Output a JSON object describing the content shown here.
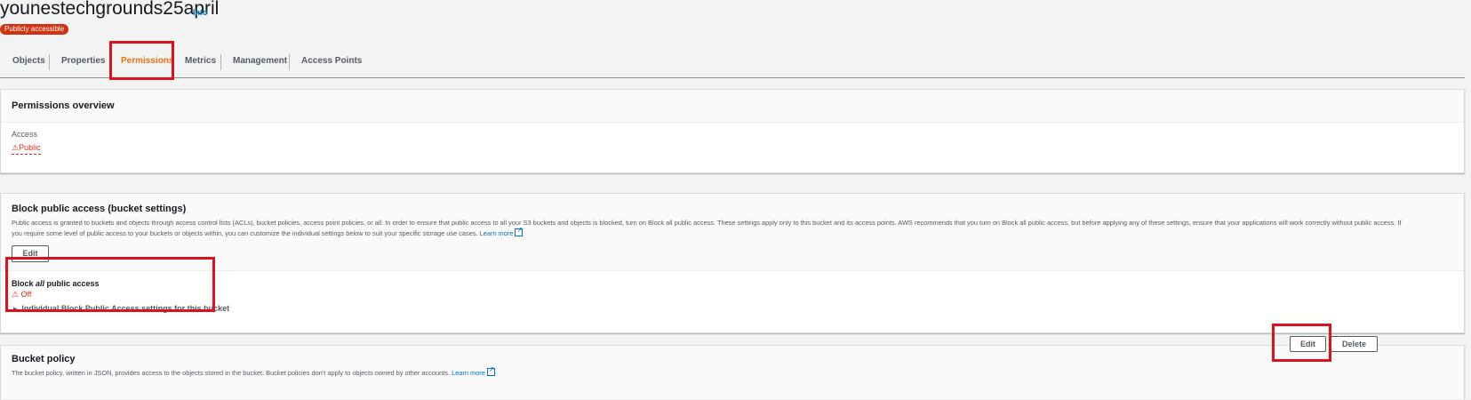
{
  "bucket": {
    "name": "younestechgrounds25april",
    "info_label": "Info",
    "badge": "Publicly accessible"
  },
  "tabs": [
    {
      "label": "Objects"
    },
    {
      "label": "Properties"
    },
    {
      "label": "Permissions"
    },
    {
      "label": "Metrics"
    },
    {
      "label": "Management"
    },
    {
      "label": "Access Points"
    }
  ],
  "active_tab": "Permissions",
  "permissions_overview": {
    "title": "Permissions overview",
    "access_label": "Access",
    "access_value": "Public"
  },
  "block_public_access": {
    "title": "Block public access (bucket settings)",
    "description_line1": "Public access is granted to buckets and objects through access control lists (ACLs), bucket policies, access point policies, or all. In order to ensure that public access to all your S3 buckets and objects is blocked, turn on Block all public access. These settings apply only to this bucket and its access points. AWS recommends that you turn on Block all public access, but before applying any of these settings, ensure that your applications will work correctly without public access. If",
    "description_line2": "you require some level of public access to your buckets or objects within, you can customize the individual settings below to suit your specific storage use cases.",
    "learn_more": "Learn more",
    "edit_label": "Edit",
    "block_all_prefix": "Block ",
    "block_all_emph": "all",
    "block_all_suffix": " public access",
    "status": "Off",
    "individual_settings": "Individual Block Public Access settings for this bucket"
  },
  "bucket_policy": {
    "title": "Bucket policy",
    "description": "The bucket policy, written in JSON, provides access to the objects stored in the bucket. Bucket policies don't apply to objects owned by other accounts.",
    "learn_more": "Learn more",
    "edit_label": "Edit",
    "delete_label": "Delete"
  },
  "colors": {
    "accent_orange": "#ec7211",
    "danger_red": "#d13212",
    "link_blue": "#0073bb",
    "highlight_red": "#e0111c"
  },
  "icons": [
    "warning-icon",
    "external-link-icon",
    "caret-right-icon"
  ]
}
